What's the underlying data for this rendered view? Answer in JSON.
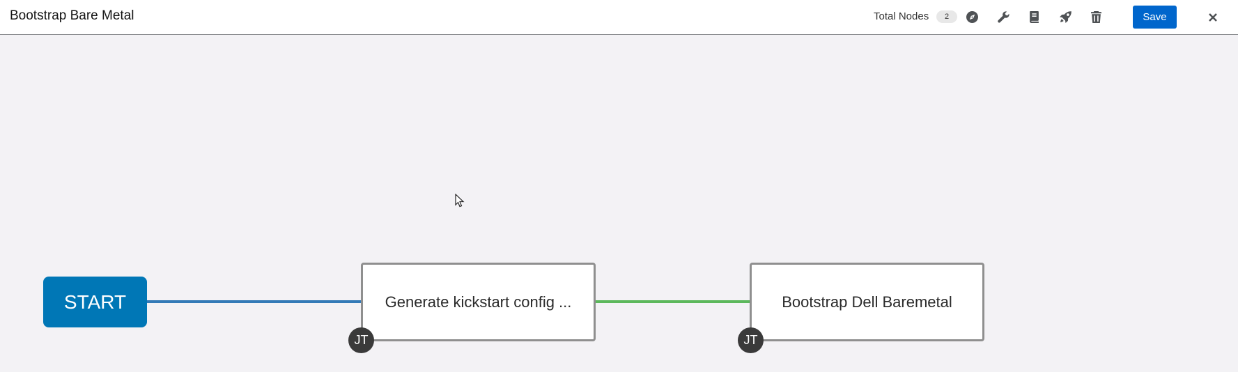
{
  "header": {
    "title": "Bootstrap Bare Metal",
    "total_nodes_label": "Total Nodes",
    "total_nodes_count": "2",
    "toolbar_icons": [
      "compass-icon",
      "wrench-icon",
      "book-icon",
      "rocket-icon",
      "trash-icon"
    ],
    "save_label": "Save"
  },
  "workflow": {
    "start_label": "START",
    "nodes": [
      {
        "label": "Generate kickstart config ...",
        "type_badge": "JT"
      },
      {
        "label": "Bootstrap Dell Baremetal",
        "type_badge": "JT"
      }
    ],
    "links": [
      {
        "from": "START",
        "to": "Generate kickstart config ...",
        "color": "#337ab7"
      },
      {
        "from": "Generate kickstart config ...",
        "to": "Bootstrap Dell Baremetal",
        "color": "#5cb85c"
      }
    ]
  },
  "colors": {
    "start_node": "#0077b6",
    "save_button": "#0066cc",
    "canvas_background": "#f3f2f5"
  }
}
